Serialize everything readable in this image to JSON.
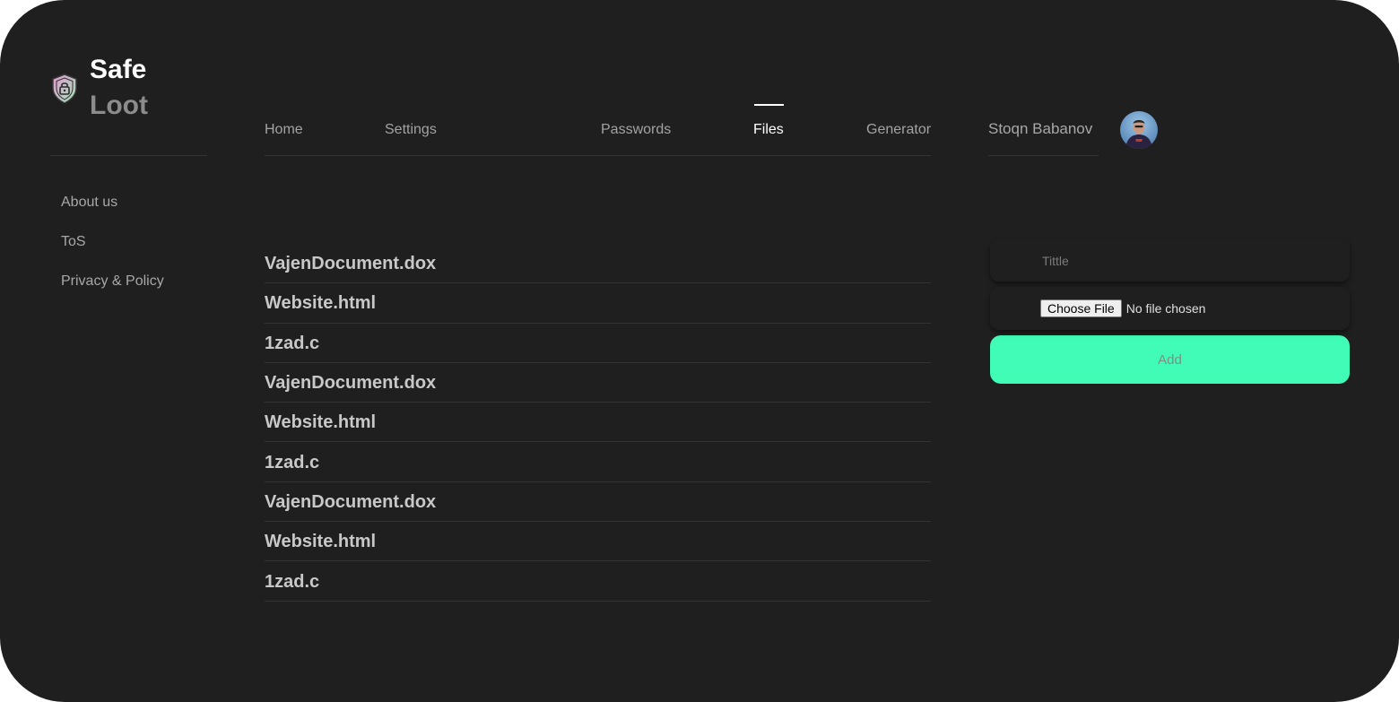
{
  "brand": {
    "line1": "Safe",
    "line2": "Loot",
    "icon": "shield-lock-icon"
  },
  "sidebar": {
    "links": [
      {
        "label": "About us"
      },
      {
        "label": "ToS"
      },
      {
        "label": "Privacy & Policy"
      }
    ]
  },
  "nav": {
    "items": [
      {
        "label": "Home"
      },
      {
        "label": "Settings"
      },
      {
        "label": "Passwords"
      },
      {
        "label": "Files",
        "active": true
      },
      {
        "label": "Generator"
      }
    ]
  },
  "user": {
    "name": "Stoqn Babanov",
    "avatar_icon": "user-avatar"
  },
  "files": [
    {
      "name": "VajenDocument.dox"
    },
    {
      "name": "Website.html"
    },
    {
      "name": "1zad.c"
    },
    {
      "name": "VajenDocument.dox"
    },
    {
      "name": "Website.html"
    },
    {
      "name": "1zad.c"
    },
    {
      "name": "VajenDocument.dox"
    },
    {
      "name": "Website.html"
    },
    {
      "name": "1zad.c"
    }
  ],
  "form": {
    "title_placeholder": "Tittle",
    "title_value": "",
    "choose_file_label": "Choose File",
    "file_status": "No file chosen",
    "add_label": "Add"
  },
  "colors": {
    "background": "#1f1f1f",
    "accent": "#40fcb7",
    "text_muted": "#a8a8a8",
    "text_active": "#ffffff"
  }
}
